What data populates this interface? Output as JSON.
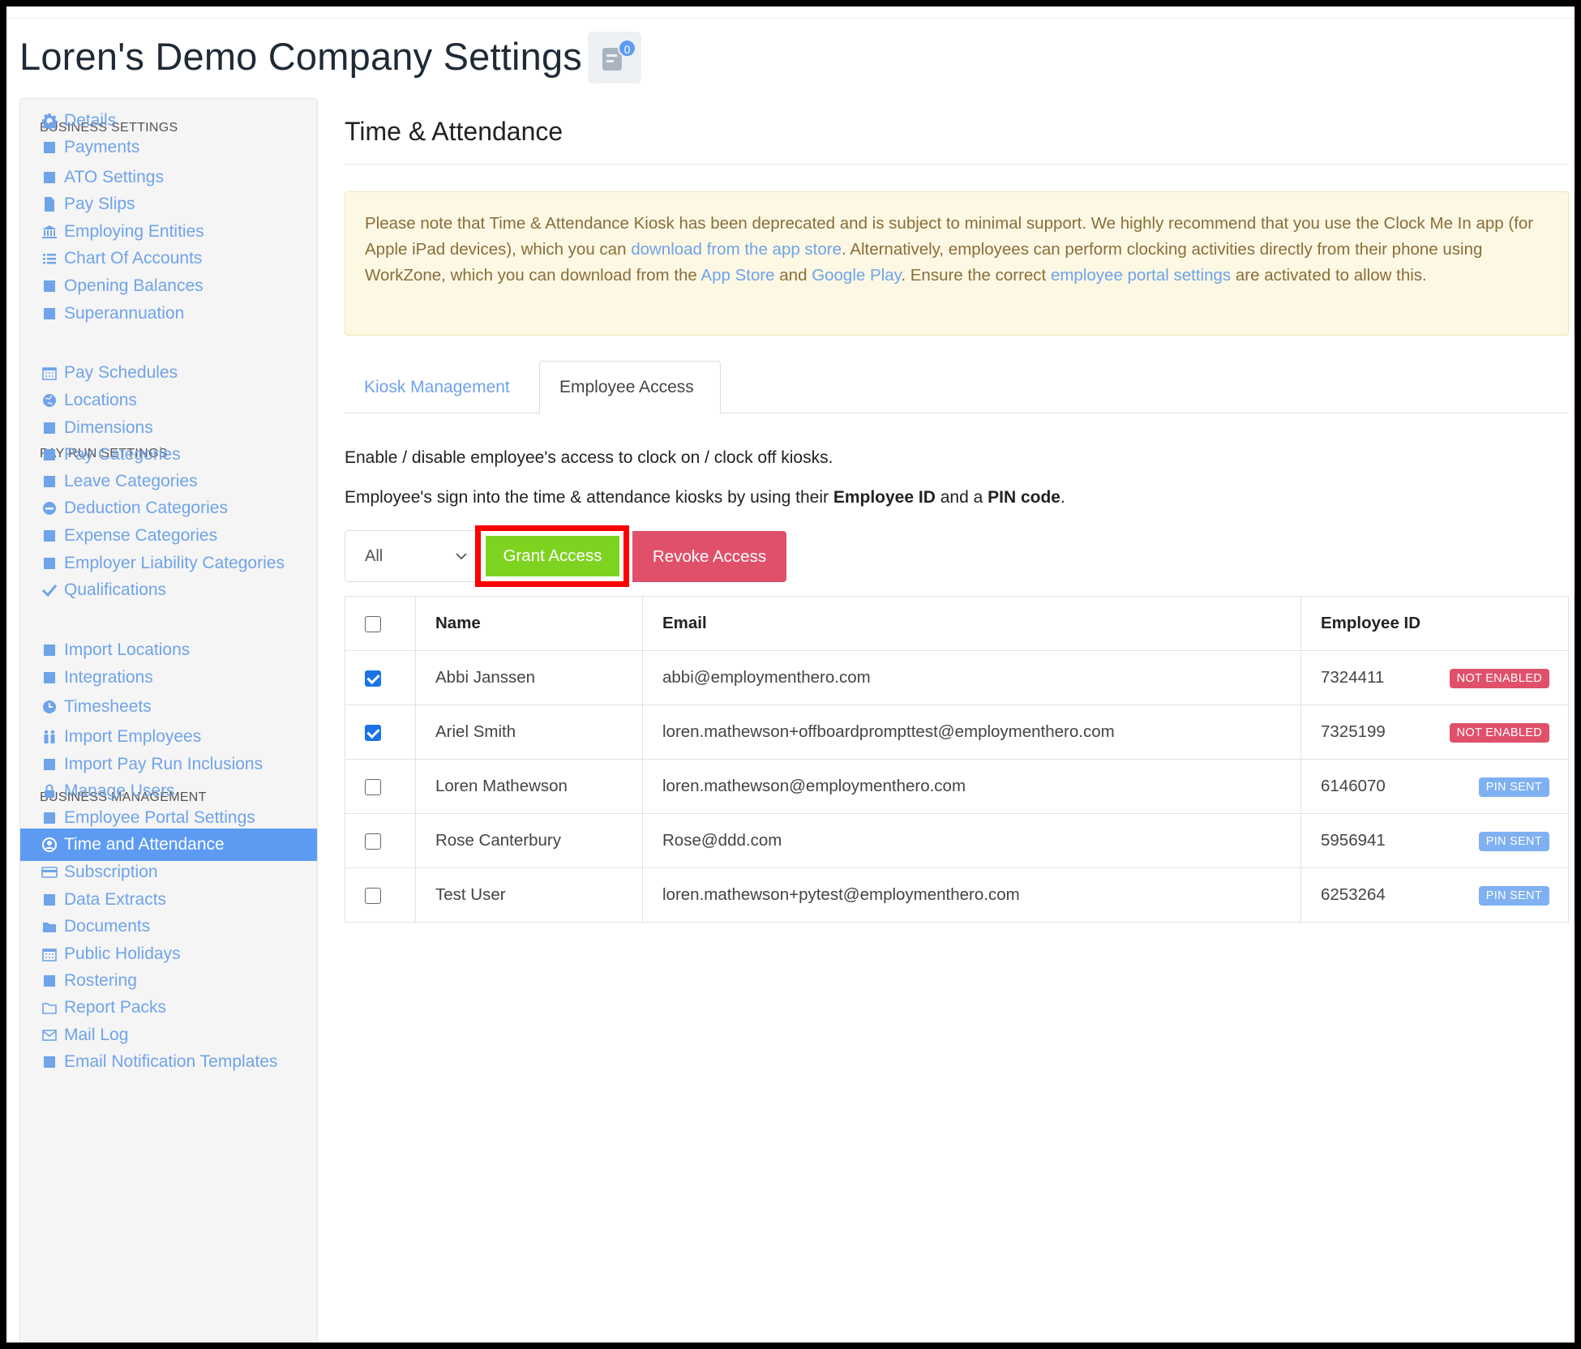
{
  "page": {
    "title": "Loren's Demo Company Settings",
    "notification_count": "0"
  },
  "sidebar": {
    "sections": [
      {
        "label": "BUSINESS SETTINGS"
      },
      {
        "label": "PAY RUN SETTINGS"
      },
      {
        "label": "BUSINESS MANAGEMENT"
      }
    ],
    "items": [
      {
        "label": "Details",
        "icon": "gear-icon"
      },
      {
        "label": "Payments",
        "icon": "floppy-icon"
      },
      {
        "label": "ATO Settings",
        "icon": "scales-icon"
      },
      {
        "label": "Pay Slips",
        "icon": "document-icon"
      },
      {
        "label": "Employing Entities",
        "icon": "bank-icon"
      },
      {
        "label": "Chart Of Accounts",
        "icon": "list-icon"
      },
      {
        "label": "Opening Balances",
        "icon": "wallet-icon"
      },
      {
        "label": "Superannuation",
        "icon": "lifebuoy-icon"
      },
      {
        "label": "Pay Schedules",
        "icon": "calendar-icon"
      },
      {
        "label": "Locations",
        "icon": "globe-icon"
      },
      {
        "label": "Dimensions",
        "icon": "bar-chart-icon"
      },
      {
        "label": "Pay Categories",
        "icon": "money-icon"
      },
      {
        "label": "Leave Categories",
        "icon": "plane-icon"
      },
      {
        "label": "Deduction Categories",
        "icon": "minus-circle-icon"
      },
      {
        "label": "Expense Categories",
        "icon": "dollar-circle-icon"
      },
      {
        "label": "Employer Liability Categories",
        "icon": "area-chart-icon"
      },
      {
        "label": "Qualifications",
        "icon": "check-icon"
      },
      {
        "label": "Import Locations",
        "icon": "map-pin-icon"
      },
      {
        "label": "Integrations",
        "icon": "share-icon"
      },
      {
        "label": "Timesheets",
        "icon": "clock-icon"
      },
      {
        "label": "Import Employees",
        "icon": "people-icon"
      },
      {
        "label": "Import Pay Run Inclusions",
        "icon": "refresh-icon"
      },
      {
        "label": "Manage Users",
        "icon": "lock-icon"
      },
      {
        "label": "Employee Portal Settings",
        "icon": "wand-icon"
      },
      {
        "label": "Time and Attendance",
        "icon": "user-circle-icon"
      },
      {
        "label": "Subscription",
        "icon": "credit-card-icon"
      },
      {
        "label": "Data Extracts",
        "icon": "cloud-download-icon"
      },
      {
        "label": "Documents",
        "icon": "folder-icon"
      },
      {
        "label": "Public Holidays",
        "icon": "calendar-icon"
      },
      {
        "label": "Rostering",
        "icon": "calendar-grid-icon"
      },
      {
        "label": "Report Packs",
        "icon": "folder-open-icon"
      },
      {
        "label": "Mail Log",
        "icon": "envelope-icon"
      },
      {
        "label": "Email Notification Templates",
        "icon": "envelope-gear-icon"
      }
    ],
    "active_item": "Time and Attendance"
  },
  "main": {
    "title": "Time & Attendance",
    "notice": {
      "t1": "Please note that Time & Attendance Kiosk has been deprecated and is subject to minimal support. We highly recommend that you use the Clock Me In app (for Apple iPad devices), which you can ",
      "link1": "download from the app store",
      "t2": ". Alternatively, employees can perform clocking activities directly from their phone using WorkZone, which you can download from the ",
      "link2": "App Store",
      "t3": " and ",
      "link3": "Google Play",
      "t4": ". Ensure the correct ",
      "link4": "employee portal settings",
      "t5": " are activated to allow this."
    },
    "tabs": [
      {
        "label": "Kiosk Management",
        "active": false
      },
      {
        "label": "Employee Access",
        "active": true
      }
    ],
    "desc1": "Enable / disable employee's access to clock on / clock off kiosks.",
    "desc2_pre": "Employee's sign into the time & attendance kiosks by using their ",
    "desc2_b1": "Employee ID",
    "desc2_mid": " and a ",
    "desc2_b2": "PIN code",
    "desc2_post": ".",
    "filter_value": "All",
    "grant_label": "Grant Access",
    "revoke_label": "Revoke Access",
    "table": {
      "headers": [
        "Name",
        "Email",
        "Employee ID"
      ],
      "rows": [
        {
          "checked": true,
          "name": "Abbi Janssen",
          "email": "abbi@employmenthero.com",
          "id": "7324411",
          "status": "NOT ENABLED"
        },
        {
          "checked": true,
          "name": "Ariel Smith",
          "email": "loren.mathewson+offboardprompttest@employmenthero.com",
          "id": "7325199",
          "status": "NOT ENABLED"
        },
        {
          "checked": false,
          "name": "Loren Mathewson",
          "email": "loren.mathewson@employmenthero.com",
          "id": "6146070",
          "status": "PIN SENT"
        },
        {
          "checked": false,
          "name": "Rose Canterbury",
          "email": "Rose@ddd.com",
          "id": "5956941",
          "status": "PIN SENT"
        },
        {
          "checked": false,
          "name": "Test User",
          "email": "loren.mathewson+pytest@employmenthero.com",
          "id": "6253264",
          "status": "PIN SENT"
        }
      ]
    },
    "colors": {
      "accent": "#5d9bf3",
      "link": "#6fa3ea",
      "grant": "#7ed321",
      "revoke": "#e0506a",
      "not_enabled": "#e0506a",
      "pin_sent": "#7fb0f2"
    }
  }
}
